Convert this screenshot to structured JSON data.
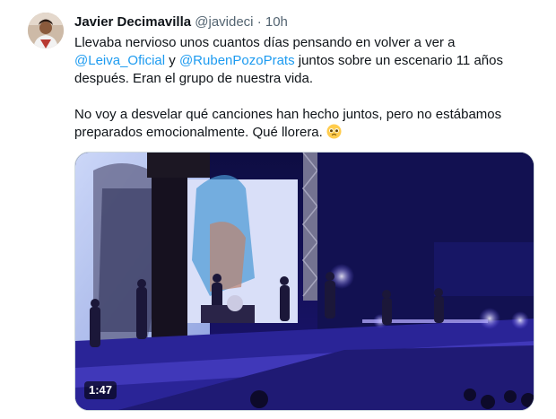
{
  "tweet": {
    "author_name": "Javier Decimavilla",
    "handle": "@javideci",
    "separator": "·",
    "time": "10h",
    "text": {
      "line1_pre": "Llevaba nervioso unos cuantos días pensando en volver a ver a ",
      "mention1": "@Leiva_Oficial",
      "mid": " y ",
      "mention2": "@RubenPozoPrats",
      "line1_post": " juntos sobre un escenario 11 años después. Eran el grupo de nuestra vida.",
      "paragraph2": "No voy a desvelar qué canciones han hecho juntos, pero no estábamos preparados emocionalmente. Qué llorera. ",
      "emoji_icon": "pleading-face-emoji"
    },
    "media": {
      "type": "video",
      "duration": "1:47"
    }
  },
  "colors": {
    "text": "#0f1419",
    "secondary": "#536471",
    "link": "#1d9bf0",
    "border": "#cfd9de"
  }
}
